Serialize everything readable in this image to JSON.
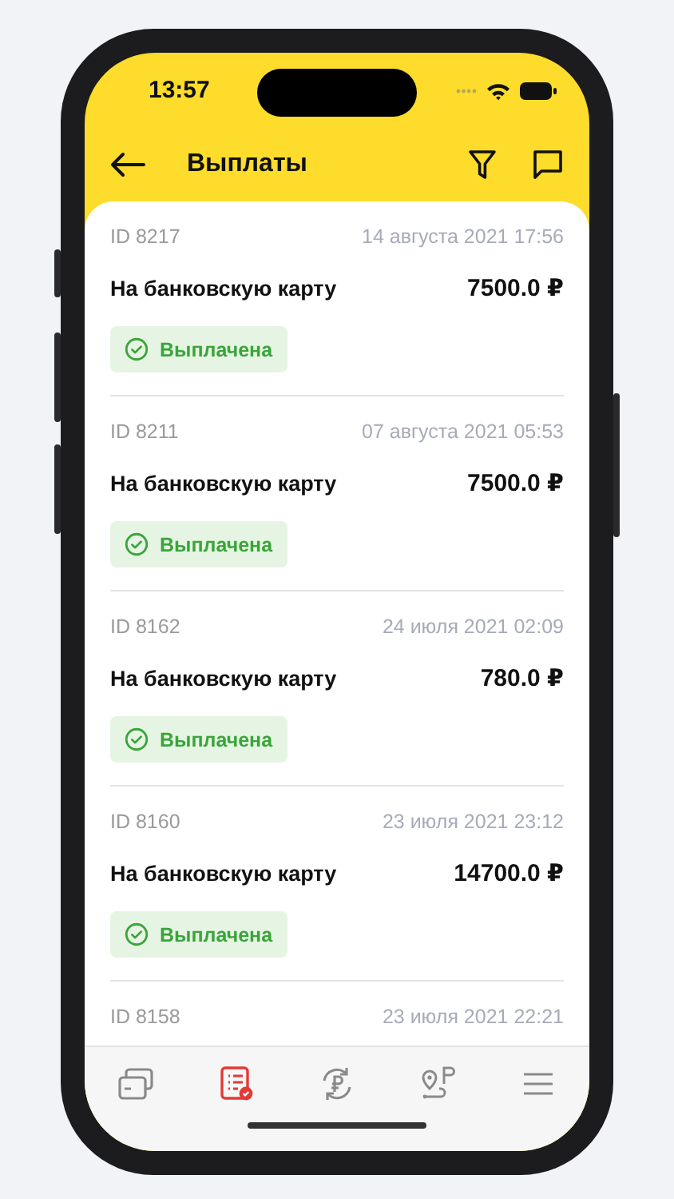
{
  "status_bar": {
    "time": "13:57"
  },
  "nav": {
    "title": "Выплаты"
  },
  "payouts": [
    {
      "id": "ID 8217",
      "date": "14 августа 2021 17:56",
      "method": "На банковскую карту",
      "amount": "7500.0 ₽",
      "status": "Выплачена"
    },
    {
      "id": "ID 8211",
      "date": "07 августа 2021 05:53",
      "method": "На банковскую карту",
      "amount": "7500.0 ₽",
      "status": "Выплачена"
    },
    {
      "id": "ID 8162",
      "date": "24 июля 2021 02:09",
      "method": "На банковскую карту",
      "amount": "780.0 ₽",
      "status": "Выплачена"
    },
    {
      "id": "ID 8160",
      "date": "23 июля 2021 23:12",
      "method": "На банковскую карту",
      "amount": "14700.0 ₽",
      "status": "Выплачена"
    },
    {
      "id": "ID 8158",
      "date": "23 июля 2021 22:21"
    }
  ],
  "tab_bar": [
    {
      "kind": "cards",
      "selected": false
    },
    {
      "kind": "payouts",
      "selected": true
    },
    {
      "kind": "exchange",
      "selected": false
    },
    {
      "kind": "route",
      "selected": false
    },
    {
      "kind": "menu",
      "selected": false
    }
  ]
}
